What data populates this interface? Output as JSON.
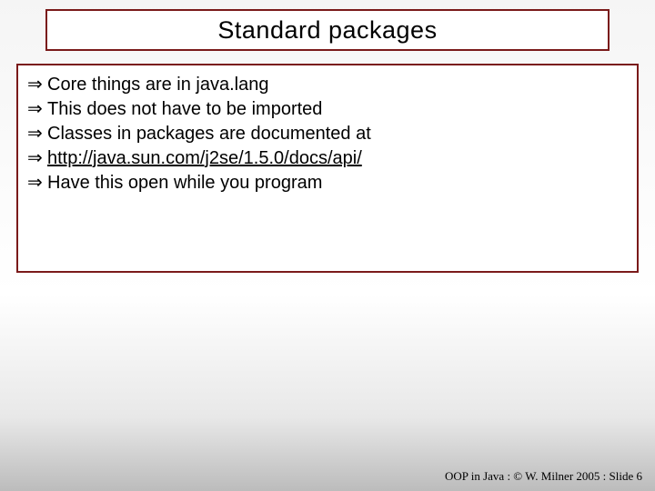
{
  "title": "Standard packages",
  "bullets": {
    "b0": "Core things are in java.lang",
    "b1": "This does not have to be imported",
    "b2": "Classes in packages are documented at",
    "b3": "http://java.sun.com/j2se/1.5.0/docs/api/",
    "b4": "Have this open while you program"
  },
  "footer": "OOP in Java : © W. Milner 2005 : Slide 6"
}
